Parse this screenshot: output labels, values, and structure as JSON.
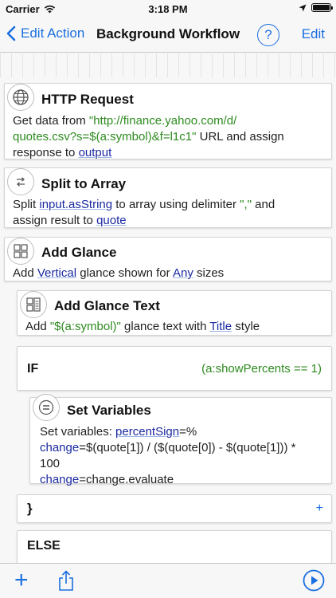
{
  "status_bar": {
    "carrier": "Carrier",
    "time": "3:18 PM"
  },
  "nav": {
    "back_label": "Edit Action",
    "title": "Background Workflow",
    "help_label": "?",
    "edit_label": "Edit"
  },
  "cards": {
    "http": {
      "title": "HTTP Request",
      "p1": "Get data from ",
      "url1": "\"http://finance.yahoo.com/d/",
      "url2": "quotes.csv?s=$(a:symbol)&f=l1c1\"",
      "p2": " URL and assign",
      "p3": "response to ",
      "var": "output"
    },
    "split": {
      "title": "Split to Array",
      "p1": "Split ",
      "var1": "input.asString",
      "p2": " to array using delimiter ",
      "delim": "\",\"",
      "p3": " and",
      "p4": "assign result to ",
      "var2": "quote"
    },
    "glance": {
      "title": "Add Glance",
      "p1": "Add ",
      "var1": "Vertical",
      "p2": " glance shown for ",
      "var2": "Any",
      "p3": " sizes"
    },
    "glance_text": {
      "title": "Add Glance Text",
      "p1": "Add ",
      "str": "\"$(a:symbol)\"",
      "p2": " glance text with ",
      "var": "Title",
      "p3": " style"
    },
    "if": {
      "keyword": "IF",
      "condition": "(a:showPercents == 1)"
    },
    "set_vars": {
      "title": "Set Variables",
      "p1": "Set variables: ",
      "v1": "percentSign",
      "a1": "=%",
      "v2": "change",
      "a2": "=$(quote[1]) / ($(quote[0]) - $(quote[1])) *",
      "a2b": "100",
      "v3": "change",
      "a3": "=change.evaluate"
    },
    "close": {
      "symbol": "}",
      "plus": "+"
    },
    "else": {
      "keyword": "ELSE"
    }
  },
  "toolbar": {
    "add": "+"
  },
  "colors": {
    "accent": "#1a6fe0",
    "variable": "#1b2aa0",
    "string": "#2d8a1f"
  }
}
